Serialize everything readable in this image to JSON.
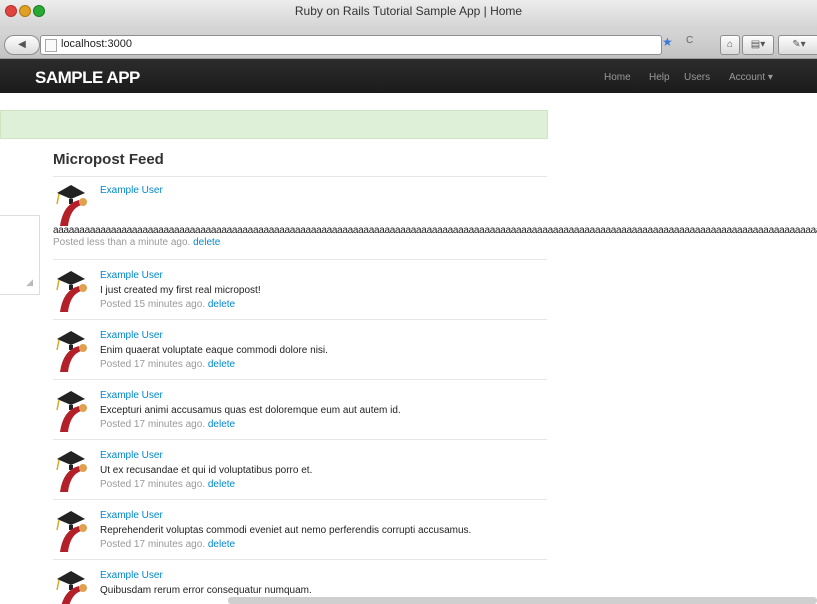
{
  "window": {
    "title": "Ruby on Rails Tutorial Sample App | Home"
  },
  "browser": {
    "url": "localhost:3000",
    "star": "★",
    "reload": "C",
    "home": "⌂"
  },
  "navbar": {
    "brand": "SAMPLE APP",
    "links": [
      "Home",
      "Help",
      "Users",
      "Account ▾"
    ]
  },
  "feed": {
    "title": "Micropost Feed",
    "delete_label": "delete",
    "items": [
      {
        "user": "Example User",
        "content": "aaaaaaaaaaaaaaaaaaaaaaaaaaaaaaaaaaaaaaaaaaaaaaaaaaaaaaaaaaaaaaaaaaaaaaaaaaaaaaaaaaaaaaaaaaaaaaaaaaaaaaaaaaaaaaaaaaaaaaaaaaaaaaaaaaaaaaaaaaaaaaaaaaaaaaaaaaaaaaaaaaaaaaaa",
        "posted": "Posted less than a minute ago."
      },
      {
        "user": "Example User",
        "content": "I just created my first real micropost!",
        "posted": "Posted 15 minutes ago."
      },
      {
        "user": "Example User",
        "content": "Enim quaerat voluptate eaque commodi dolore nisi.",
        "posted": "Posted 17 minutes ago."
      },
      {
        "user": "Example User",
        "content": "Excepturi animi accusamus quas est doloremque eum aut autem id.",
        "posted": "Posted 17 minutes ago."
      },
      {
        "user": "Example User",
        "content": "Ut ex recusandae et qui id voluptatibus porro et.",
        "posted": "Posted 17 minutes ago."
      },
      {
        "user": "Example User",
        "content": "Reprehenderit voluptas commodi eveniet aut nemo perferendis corrupti accusamus.",
        "posted": "Posted 17 minutes ago."
      },
      {
        "user": "Example User",
        "content": "Quibusdam rerum error consequatur numquam.",
        "posted": ""
      }
    ]
  }
}
